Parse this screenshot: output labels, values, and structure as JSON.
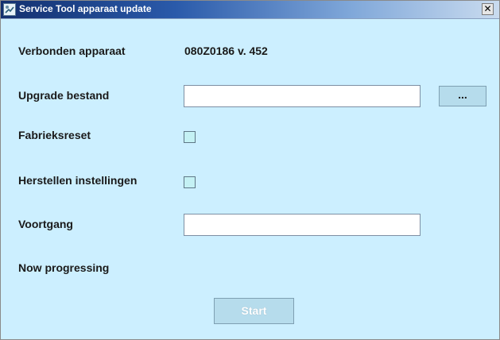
{
  "window": {
    "title": "Service Tool apparaat update",
    "close_glyph": "✕"
  },
  "connected_device": {
    "label": "Verbonden apparaat",
    "value": "080Z0186  v. 452"
  },
  "upgrade_file": {
    "label": "Upgrade bestand",
    "value": "",
    "browse_label": "..."
  },
  "factory_reset": {
    "label": "Fabrieksreset",
    "checked": false
  },
  "restore_settings": {
    "label": "Herstellen instellingen",
    "checked": false
  },
  "progress": {
    "label": "Voortgang",
    "value": ""
  },
  "status": {
    "text": "Now progressing"
  },
  "start_button": {
    "label": "Start",
    "enabled": false
  },
  "colors": {
    "window_background": "#ccefff",
    "button_background": "#b6dcec",
    "checkbox_fill": "#c4f1f4",
    "titlebar_start": "#13306f"
  },
  "icons": {
    "app": "app-icon",
    "close": "close-icon"
  }
}
